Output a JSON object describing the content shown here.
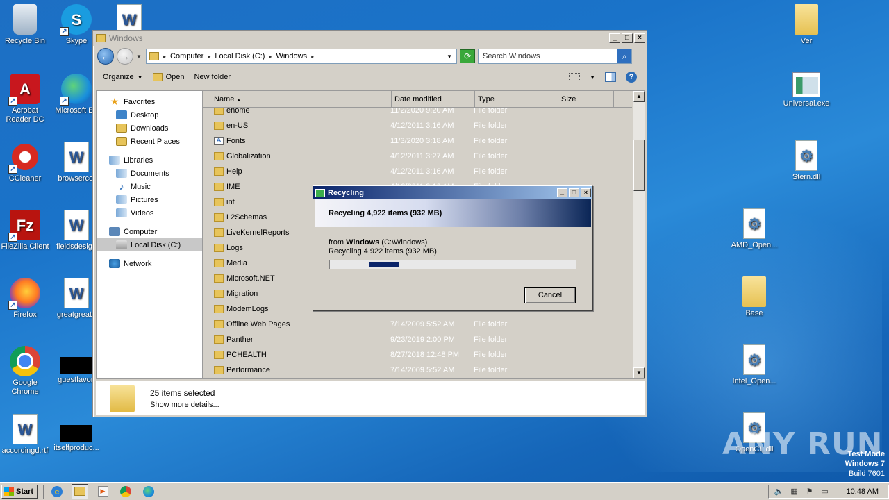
{
  "desktop": {
    "left_icons": [
      {
        "label": "Recycle Bin",
        "icon": "recycle-bin-icon"
      },
      {
        "label": "Skype",
        "icon": "skype-icon"
      },
      {
        "label": "Acrobat Reader DC",
        "icon": "acrobat-icon"
      },
      {
        "label": "Microsoft Ed",
        "icon": "edge-icon"
      },
      {
        "label": "CCleaner",
        "icon": "ccleaner-icon"
      },
      {
        "label": "browsercol",
        "icon": "word-doc-icon"
      },
      {
        "label": "FileZilla Client",
        "icon": "filezilla-icon"
      },
      {
        "label": "fieldsdesign",
        "icon": "word-doc-icon"
      },
      {
        "label": "Firefox",
        "icon": "firefox-icon"
      },
      {
        "label": "greatgreate",
        "icon": "word-doc-icon"
      },
      {
        "label": "Google Chrome",
        "icon": "chrome-icon"
      },
      {
        "label": "guestfavori",
        "icon": "black-file-icon"
      },
      {
        "label": "accordingd.rtf",
        "icon": "word-doc-icon"
      },
      {
        "label": "itselfproduc...",
        "icon": "black-file-icon"
      }
    ],
    "right_icons": [
      {
        "label": "Ver",
        "icon": "folder-icon"
      },
      {
        "label": "Universal.exe",
        "icon": "exe-icon"
      },
      {
        "label": "Stern.dll",
        "icon": "dll-icon"
      },
      {
        "label": "AMD_Open...",
        "icon": "dll-icon"
      },
      {
        "label": "Base",
        "icon": "folder-icon"
      },
      {
        "label": "Intel_Open...",
        "icon": "dll-icon"
      },
      {
        "label": "OpenCL.dll",
        "icon": "dll-icon"
      }
    ]
  },
  "explorer": {
    "title": "Windows",
    "breadcrumb": [
      "Computer",
      "Local Disk (C:)",
      "Windows"
    ],
    "search_placeholder": "Search Windows",
    "toolbar": {
      "organize": "Organize",
      "open": "Open",
      "new_folder": "New folder"
    },
    "nav": {
      "favorites": "Favorites",
      "desktop": "Desktop",
      "downloads": "Downloads",
      "recent": "Recent Places",
      "libraries": "Libraries",
      "documents": "Documents",
      "music": "Music",
      "pictures": "Pictures",
      "videos": "Videos",
      "computer": "Computer",
      "local_disk": "Local Disk (C:)",
      "network": "Network"
    },
    "columns": {
      "name": "Name",
      "date": "Date modified",
      "type": "Type",
      "size": "Size"
    },
    "rows": [
      {
        "name": "ehome",
        "date": "11/2/2020 9:20 AM",
        "type": "File folder"
      },
      {
        "name": "en-US",
        "date": "4/12/2011 3:16 AM",
        "type": "File folder"
      },
      {
        "name": "Fonts",
        "date": "11/3/2020 3:18 AM",
        "type": "File folder"
      },
      {
        "name": "Globalization",
        "date": "4/12/2011 3:27 AM",
        "type": "File folder"
      },
      {
        "name": "Help",
        "date": "4/12/2011 3:16 AM",
        "type": "File folder"
      },
      {
        "name": "IME",
        "date": "4/12/2011 3:16 AM",
        "type": "File folder"
      },
      {
        "name": "inf",
        "date": "",
        "type": ""
      },
      {
        "name": "L2Schemas",
        "date": "",
        "type": ""
      },
      {
        "name": "LiveKernelReports",
        "date": "",
        "type": ""
      },
      {
        "name": "Logs",
        "date": "",
        "type": ""
      },
      {
        "name": "Media",
        "date": "",
        "type": ""
      },
      {
        "name": "Microsoft.NET",
        "date": "",
        "type": ""
      },
      {
        "name": "Migration",
        "date": "",
        "type": ""
      },
      {
        "name": "ModemLogs",
        "date": "",
        "type": ""
      },
      {
        "name": "Offline Web Pages",
        "date": "7/14/2009 5:52 AM",
        "type": "File folder"
      },
      {
        "name": "Panther",
        "date": "9/23/2019 2:00 PM",
        "type": "File folder"
      },
      {
        "name": "PCHEALTH",
        "date": "8/27/2018 12:48 PM",
        "type": "File folder"
      },
      {
        "name": "Performance",
        "date": "7/14/2009 5:52 AM",
        "type": "File folder"
      }
    ],
    "details": {
      "count": "25 items selected",
      "more": "Show more details..."
    }
  },
  "dialog": {
    "title": "Recycling",
    "heading": "Recycling 4,922 items (932 MB)",
    "from_prefix": "from ",
    "from_bold": "Windows",
    "from_path": " (C:\\Windows)",
    "status": "Recycling 4,922 items (932 MB)",
    "progress_marquee_start": 0.16,
    "progress_marquee_end": 0.28,
    "cancel": "Cancel"
  },
  "taskbar": {
    "start": "Start",
    "clock": "10:48 AM"
  },
  "overlay": {
    "test_mode": "Test Mode",
    "os": "Windows 7",
    "build": "Build 7601",
    "watermark": "ANY RUN"
  }
}
